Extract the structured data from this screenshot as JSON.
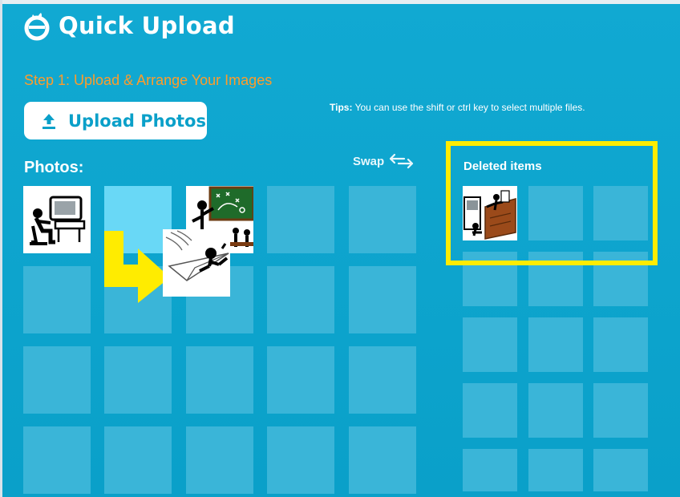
{
  "app": {
    "title": "Quick Upload",
    "accent_color": "#0aa0c9",
    "step_color": "#ff9c2a",
    "highlight_color": "#ffec00"
  },
  "step": {
    "label": "Step 1: Upload & Arrange Your Images"
  },
  "upload": {
    "label": "Upload Photos",
    "icon": "upload-icon"
  },
  "tips": {
    "prefix": "Tips:",
    "text": " You can use the shift or ctrl key to select multiple files."
  },
  "photos": {
    "title": "Photos:",
    "thumbnails": [
      "person-at-computer-image",
      "teacher-at-chalkboard-image",
      "paper-airplane-image"
    ]
  },
  "swap": {
    "label": "Swap",
    "icon": "swap-arrows-icon"
  },
  "deleted": {
    "title": "Deleted items",
    "thumbnails": [
      "person-at-desk-image"
    ]
  }
}
